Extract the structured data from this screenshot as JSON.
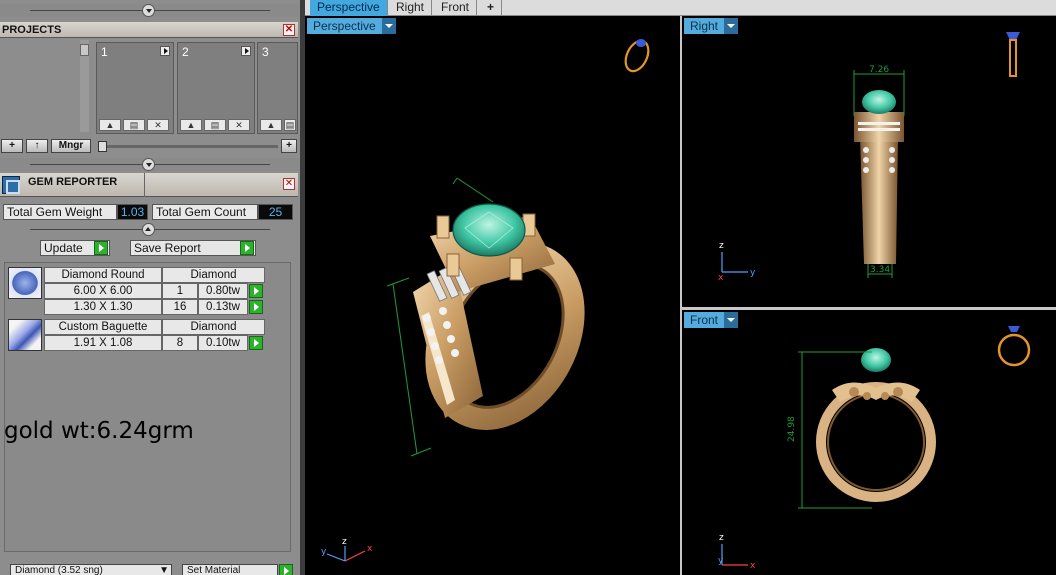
{
  "projects": {
    "title": "PROJECTS",
    "slots": [
      "1",
      "2",
      "3"
    ],
    "mngr_label": "Mngr",
    "plus_label": "+",
    "up_label": "↑"
  },
  "gem_reporter": {
    "title": "GEM REPORTER",
    "total_weight_label": "Total Gem Weight",
    "total_weight_value": "1.03",
    "total_count_label": "Total Gem Count",
    "total_count_value": "25",
    "update_label": "Update",
    "save_report_label": "Save Report",
    "gems": [
      {
        "name": "Diamond Round",
        "material": "Diamond",
        "sizes": [
          {
            "dims": "6.00 X 6.00",
            "count": "1",
            "weight": "0.80tw"
          },
          {
            "dims": "1.30 X 1.30",
            "count": "16",
            "weight": "0.13tw"
          }
        ]
      },
      {
        "name": "Custom Baguette",
        "material": "Diamond",
        "sizes": [
          {
            "dims": "1.91 X 1.08",
            "count": "8",
            "weight": "0.10tw"
          }
        ]
      }
    ],
    "note": "gold wt:6.24grm",
    "material_select": "Diamond     (3.52 sng)",
    "set_material_label": "Set Material"
  },
  "tabs": [
    "Perspective",
    "Right",
    "Front",
    "+"
  ],
  "viewports": {
    "perspective": {
      "label": "Perspective"
    },
    "right": {
      "label": "Right",
      "dim_top": "7.26",
      "dim_bottom": "3.34"
    },
    "front": {
      "label": "Front",
      "dim_side": "24.98"
    }
  },
  "colors": {
    "gold": "#d9b383",
    "gem": "#3fc7a4",
    "dim_line": "#1f9b3d",
    "accent": "#43a7e0"
  }
}
